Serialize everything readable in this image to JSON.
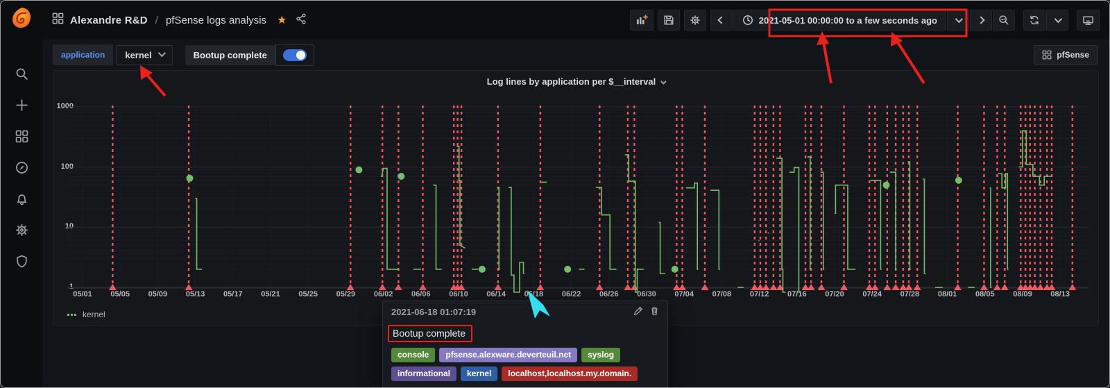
{
  "sidebar": {
    "logo_name": "grafana-logo",
    "items": [
      {
        "name": "search"
      },
      {
        "name": "create"
      },
      {
        "name": "dashboards"
      },
      {
        "name": "explore"
      },
      {
        "name": "alerting"
      },
      {
        "name": "configuration"
      },
      {
        "name": "server-admin"
      }
    ]
  },
  "header": {
    "breadcrumb_folder": "Alexandre R&D",
    "breadcrumb_sep": "/",
    "breadcrumb_page": "pfSense logs analysis",
    "star": "★"
  },
  "toolbar": {
    "time_range": "2021-05-01 00:00:00 to a few seconds ago",
    "buttons": [
      "add-panel",
      "save-dashboard",
      "dashboard-settings",
      "time-back",
      "time-picker",
      "time-picker-caret",
      "time-forward",
      "zoom-out",
      "refresh",
      "refresh-interval-caret",
      "cycle-view"
    ]
  },
  "submenu": {
    "variable_label": "application",
    "variable_value": "kernel",
    "annotation_label": "Bootup complete",
    "annotation_toggle": "on",
    "dashboard_link": "pfSense"
  },
  "panel": {
    "title": "Log lines by application per $__interval"
  },
  "legend": {
    "series": "kernel"
  },
  "tooltip": {
    "time": "2021-06-18 01:07:19",
    "text": "Bootup complete",
    "tags": [
      {
        "label": "console",
        "color": "#56883c"
      },
      {
        "label": "pfsense.alexware.deverteuil.net",
        "color": "#8679c4"
      },
      {
        "label": "syslog",
        "color": "#56883c"
      },
      {
        "label": "informational",
        "color": "#5d4f94"
      },
      {
        "label": "kernel",
        "color": "#2f5ea5"
      },
      {
        "label": "localhost,localhost.my.domain.",
        "color": "#a82b25"
      }
    ]
  },
  "icons": {
    "chevron-down": "css-shape",
    "chevron-left": "css-shape",
    "chevron-right": "css-shape",
    "star": "★",
    "pencil": "svg",
    "trash": "svg",
    "clock": "svg",
    "magnifier-minus": "svg",
    "refresh": "svg",
    "monitor": "svg",
    "share": "svg",
    "grid": "svg"
  },
  "chart_data": {
    "type": "line",
    "title": "Log lines by application per $__interval",
    "series_name": "kernel",
    "line_color": "#73bf69",
    "annotation_color": "#f0575f",
    "y_axis": {
      "scale": "log10",
      "ticks": [
        1,
        10,
        100,
        1000
      ],
      "ylim": [
        1,
        1000
      ]
    },
    "x_axis": {
      "tick_interval_days": 4,
      "tick_labels": [
        "05/01",
        "05/05",
        "05/09",
        "05/13",
        "05/17",
        "05/21",
        "05/25",
        "05/29",
        "06/02",
        "06/06",
        "06/10",
        "06/14",
        "06/18",
        "06/22",
        "06/26",
        "06/30",
        "07/04",
        "07/08",
        "07/12",
        "07/16",
        "07/20",
        "07/24",
        "07/28",
        "08/01",
        "08/05",
        "08/09",
        "08/13"
      ]
    },
    "annotations_days": [
      3.2,
      11.3,
      28.5,
      31.9,
      33.6,
      36.2,
      39.5,
      39.9,
      40.3,
      44.2,
      48.7,
      55.0,
      58.0,
      58.7,
      63.2,
      63.8,
      66.2,
      71.5,
      72.1,
      72.7,
      73.5,
      74.2,
      76.9,
      77.5,
      78.6,
      81.0,
      83.7,
      84.3,
      85.6,
      86.5,
      87.3,
      87.9,
      88.8,
      93.1,
      95.9,
      97.3,
      98.1,
      99.8,
      100.3,
      100.8,
      101.3,
      101.9,
      102.6,
      103.1,
      105.3,
      107.8
    ],
    "segments": [
      [
        [
          12.0,
          30
        ],
        [
          12.15,
          30
        ],
        [
          12.15,
          2
        ],
        [
          12.7,
          2
        ]
      ],
      [
        [
          31.8,
          68
        ],
        [
          32.0,
          95
        ],
        [
          32.4,
          95
        ],
        [
          32.4,
          2
        ],
        [
          33.7,
          2
        ]
      ],
      [
        [
          35.2,
          2
        ],
        [
          36.0,
          2
        ]
      ],
      [
        [
          37.3,
          50
        ],
        [
          37.6,
          50
        ],
        [
          37.6,
          2
        ],
        [
          38.2,
          2
        ]
      ],
      [
        [
          39.8,
          220
        ],
        [
          40.05,
          220
        ],
        [
          40.05,
          60
        ],
        [
          40.15,
          60
        ],
        [
          40.15,
          5
        ],
        [
          40.7,
          4.5
        ]
      ],
      [
        [
          41.4,
          2
        ],
        [
          42.1,
          2
        ]
      ],
      [
        [
          44.1,
          46
        ],
        [
          44.3,
          46
        ],
        [
          44.3,
          2
        ],
        [
          44.4,
          2
        ]
      ],
      [
        [
          45.3,
          46
        ],
        [
          45.6,
          46
        ],
        [
          45.6,
          1.6
        ],
        [
          45.9,
          1.6
        ],
        [
          45.9,
          0.65
        ],
        [
          46.5,
          0.65
        ],
        [
          46.5,
          2.6
        ],
        [
          46.9,
          2.6
        ],
        [
          46.9,
          1.7
        ],
        [
          47.0,
          1.7
        ]
      ],
      [
        [
          48.8,
          56
        ],
        [
          49.4,
          56
        ]
      ],
      [
        [
          52.8,
          2
        ],
        [
          53.4,
          2
        ]
      ],
      [
        [
          54.6,
          46
        ],
        [
          55.2,
          46
        ],
        [
          55.2,
          16
        ],
        [
          56.1,
          16
        ],
        [
          56.1,
          2
        ],
        [
          56.8,
          2
        ]
      ],
      [
        [
          57.7,
          160
        ],
        [
          58.1,
          160
        ],
        [
          58.1,
          58
        ],
        [
          58.8,
          58
        ],
        [
          58.8,
          0.8
        ],
        [
          59.0,
          0.8
        ],
        [
          59.0,
          2
        ],
        [
          59.7,
          2
        ]
      ],
      [
        [
          61.3,
          12
        ],
        [
          61.45,
          12
        ],
        [
          61.45,
          1.7
        ],
        [
          62.0,
          1.7
        ]
      ],
      [
        [
          64.2,
          45
        ],
        [
          65.1,
          45
        ],
        [
          65.1,
          54
        ],
        [
          65.4,
          54
        ],
        [
          65.4,
          2
        ],
        [
          65.5,
          2
        ]
      ],
      [
        [
          66.8,
          41
        ],
        [
          67.7,
          41
        ],
        [
          67.7,
          2
        ],
        [
          67.8,
          2
        ]
      ],
      [
        [
          69.7,
          1
        ],
        [
          70.3,
          1
        ]
      ],
      [
        [
          71.9,
          6
        ],
        [
          72.0,
          6
        ]
      ],
      [
        [
          72.9,
          8
        ],
        [
          73.0,
          8
        ]
      ],
      [
        [
          73.8,
          140
        ],
        [
          74.4,
          140
        ],
        [
          74.4,
          2
        ],
        [
          74.5,
          2
        ],
        [
          74.5,
          0.7
        ],
        [
          74.8,
          0.7
        ]
      ],
      [
        [
          75.2,
          82
        ],
        [
          75.7,
          82
        ],
        [
          75.7,
          98
        ],
        [
          76.2,
          98
        ],
        [
          76.2,
          0.7
        ],
        [
          76.3,
          0.7
        ]
      ],
      [
        [
          77.1,
          147
        ],
        [
          77.4,
          147
        ],
        [
          77.4,
          2
        ],
        [
          77.5,
          2
        ]
      ],
      [
        [
          78.5,
          82
        ],
        [
          78.8,
          82
        ],
        [
          78.8,
          2
        ],
        [
          78.9,
          2
        ]
      ],
      [
        [
          80.0,
          17
        ],
        [
          80.1,
          17
        ],
        [
          80.1,
          50
        ],
        [
          81.4,
          50
        ],
        [
          81.4,
          2
        ],
        [
          82.2,
          2
        ]
      ],
      [
        [
          83.8,
          60
        ],
        [
          84.9,
          60
        ],
        [
          84.9,
          2
        ],
        [
          85.0,
          2
        ]
      ],
      [
        [
          85.9,
          82
        ],
        [
          86.5,
          82
        ],
        [
          86.5,
          2
        ],
        [
          86.6,
          2
        ]
      ],
      [
        [
          87.8,
          122
        ],
        [
          88.0,
          122
        ],
        [
          88.0,
          2
        ],
        [
          88.1,
          2
        ]
      ],
      [
        [
          89.4,
          63
        ],
        [
          89.55,
          63
        ],
        [
          89.55,
          1.7
        ],
        [
          89.7,
          1.7
        ]
      ],
      [
        [
          90.7,
          1
        ],
        [
          91.5,
          1
        ]
      ],
      [
        [
          94.2,
          1
        ],
        [
          94.9,
          1
        ]
      ],
      [
        [
          96.5,
          45
        ],
        [
          96.6,
          45
        ],
        [
          96.6,
          1
        ],
        [
          96.7,
          1
        ]
      ],
      [
        [
          97.4,
          78
        ],
        [
          97.8,
          78
        ],
        [
          97.8,
          45
        ],
        [
          98.2,
          45
        ],
        [
          98.2,
          78
        ],
        [
          98.4,
          78
        ],
        [
          98.4,
          2
        ],
        [
          98.5,
          2
        ]
      ],
      [
        [
          99.6,
          100
        ],
        [
          100.0,
          100
        ],
        [
          100.0,
          400
        ],
        [
          100.4,
          400
        ],
        [
          100.4,
          110
        ],
        [
          101.1,
          110
        ],
        [
          101.1,
          70
        ],
        [
          101.8,
          70
        ],
        [
          101.8,
          50
        ],
        [
          102.3,
          50
        ],
        [
          102.3,
          70
        ],
        [
          103.1,
          70
        ]
      ]
    ],
    "dots": [
      [
        11.4,
        65
      ],
      [
        29.4,
        90
      ],
      [
        33.9,
        70
      ],
      [
        42.5,
        2
      ],
      [
        51.6,
        2
      ],
      [
        63.0,
        2
      ],
      [
        85.5,
        50
      ],
      [
        93.2,
        60
      ]
    ]
  }
}
